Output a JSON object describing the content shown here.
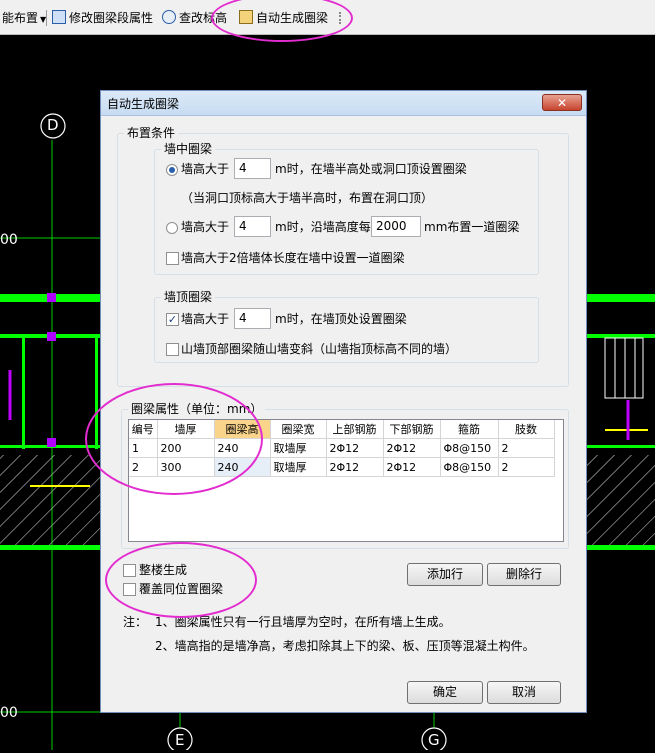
{
  "toolbar": {
    "layout_label": "能布置",
    "modify_beam_label": "修改圈梁段属性",
    "check_elevation_label": "查改标高",
    "auto_generate_label": "自动生成圈梁"
  },
  "canvas": {
    "axis_d": "D",
    "axis_e": "E",
    "axis_g": "G",
    "dim_left_1": "00",
    "dim_left_2": "00"
  },
  "dialog": {
    "title": "自动生成圈梁",
    "close_glyph": "✕",
    "layout_conditions": {
      "legend": "布置条件",
      "mid_wall": {
        "legend": "墙中圈梁",
        "option1": {
          "selected": true,
          "prefix": "墙高大于",
          "value": "4",
          "suffix": "m时，在墙半高处或洞口顶设置圈梁",
          "note": "（当洞口顶标高大于墙半高时，布置在洞口顶）"
        },
        "option2": {
          "selected": false,
          "prefix": "墙高大于",
          "value": "4",
          "middle": "m时，沿墙高度每",
          "spacing": "2000",
          "suffix": "mm布置一道圈梁"
        },
        "length_check": {
          "checked": false,
          "label": "墙高大于2倍墙体长度在墙中设置一道圈梁"
        }
      },
      "top_wall": {
        "legend": "墙顶圈梁",
        "height_check": {
          "checked": true,
          "prefix": "墙高大于",
          "value": "4",
          "suffix": "m时，在墙顶处设置圈梁"
        },
        "gable_check": {
          "checked": false,
          "label": "山墙顶部圈梁随山墙变斜（山墙指顶标高不同的墙）"
        }
      }
    },
    "properties": {
      "legend": "圈梁属性（单位：mm）",
      "columns": [
        "编号",
        "墙厚",
        "圈梁高",
        "圈梁宽",
        "上部钢筋",
        "下部钢筋",
        "箍筋",
        "肢数"
      ],
      "rows": [
        [
          "1",
          "200",
          "240",
          "取墙厚",
          "2Φ12",
          "2Φ12",
          "Φ8@150",
          "2"
        ],
        [
          "2",
          "300",
          "240",
          "取墙厚",
          "2Φ12",
          "2Φ12",
          "Φ8@150",
          "2"
        ]
      ]
    },
    "whole_building": {
      "checked": false,
      "label": "整楼生成"
    },
    "overwrite": {
      "checked": false,
      "label": "覆盖同位置圈梁"
    },
    "add_row_label": "添加行",
    "delete_row_label": "删除行",
    "note_prefix": "注：",
    "note1": "1、圈梁属性只有一行且墙厚为空时，在所有墙上生成。",
    "note2": "2、墙高指的是墙净高，考虑扣除其上下的梁、板、压顶等混凝土构件。",
    "ok_label": "确定",
    "cancel_label": "取消"
  },
  "colors": {
    "cad_background": "#000000",
    "wall_green": "#00ff00",
    "hatch_yellow": "#ffff00",
    "axis_purple": "#b000ff",
    "annotation_magenta": "#e22ccf",
    "highlight_header": "#fbd48c"
  }
}
